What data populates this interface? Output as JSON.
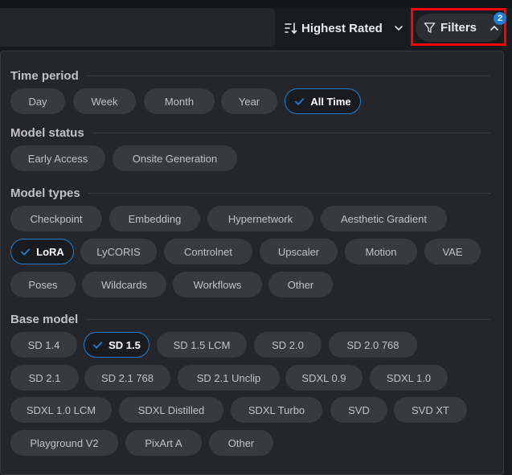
{
  "toolbar": {
    "sort_label": "Highest Rated",
    "filters_label": "Filters",
    "filters_count": "2"
  },
  "sections": {
    "time_period": {
      "title": "Time period",
      "options": [
        "Day",
        "Week",
        "Month",
        "Year",
        "All Time"
      ],
      "selected": "All Time"
    },
    "model_status": {
      "title": "Model status",
      "options": [
        "Early Access",
        "Onsite Generation"
      ]
    },
    "model_types": {
      "title": "Model types",
      "options": [
        "Checkpoint",
        "Embedding",
        "Hypernetwork",
        "Aesthetic Gradient",
        "LoRA",
        "LyCORIS",
        "Controlnet",
        "Upscaler",
        "Motion",
        "VAE",
        "Poses",
        "Wildcards",
        "Workflows",
        "Other"
      ],
      "selected": "LoRA"
    },
    "base_model": {
      "title": "Base model",
      "options": [
        "SD 1.4",
        "SD 1.5",
        "SD 1.5 LCM",
        "SD 2.0",
        "SD 2.0 768",
        "SD 2.1",
        "SD 2.1 768",
        "SD 2.1 Unclip",
        "SDXL 0.9",
        "SDXL 1.0",
        "SDXL 1.0 LCM",
        "SDXL Distilled",
        "SDXL Turbo",
        "SVD",
        "SVD XT",
        "Playground V2",
        "PixArt A",
        "Other"
      ],
      "selected": "SD 1.5"
    }
  },
  "colors": {
    "accent": "#1c7ed6",
    "highlight_outline": "#ff0000",
    "panel_bg": "#25262b",
    "chip_bg": "#373a40"
  },
  "icons": {
    "sort": "sort-descending-icon",
    "filter": "funnel-icon",
    "chevron_down": "chevron-down-icon",
    "chevron_up": "chevron-up-icon",
    "check": "check-icon"
  }
}
